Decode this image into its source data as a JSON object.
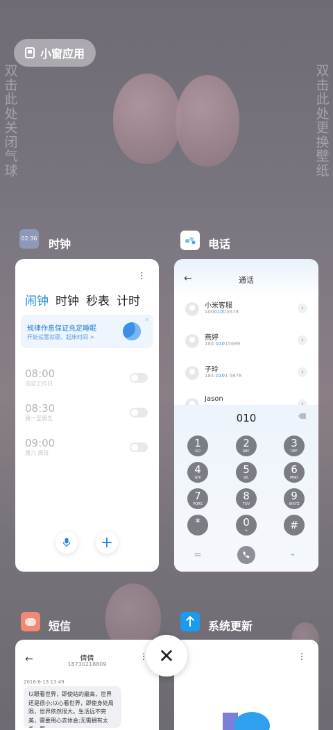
{
  "small_window": {
    "label": "小窗应用"
  },
  "hints": {
    "left": "双击此处关闭气球",
    "right": "双击此处更换壁纸"
  },
  "apps": {
    "clock": {
      "icon_time": "02:36",
      "name": "时钟",
      "tabs": [
        "闹钟",
        "时钟",
        "秒表",
        "计时"
      ],
      "banner": {
        "title": "规律作息保证充足睡眠",
        "subtitle": "开始设置就寝、起床时间 >"
      },
      "alarms": [
        {
          "time": "08:00",
          "repeat": "法定工作日"
        },
        {
          "time": "08:30",
          "repeat": "周一至周五"
        },
        {
          "time": "09:00",
          "repeat": "周六 周日"
        }
      ]
    },
    "phone": {
      "name": "电话",
      "header": "通话",
      "contacts": [
        {
          "name": "小米客服",
          "pre": "400",
          "hl": "010",
          "post": "05678"
        },
        {
          "name": "燕婷",
          "pre": "184 ",
          "hl": "010",
          "post": "15689"
        },
        {
          "name": "子玲",
          "pre": "184 ",
          "hl": "010",
          "post": "1 5678"
        },
        {
          "name": "Jason",
          "pre": "",
          "hl": "",
          "post": ""
        }
      ],
      "dial_input": "010",
      "keys": [
        {
          "n": "1",
          "l": "GO"
        },
        {
          "n": "2",
          "l": "ABC"
        },
        {
          "n": "3",
          "l": "DEF"
        },
        {
          "n": "4",
          "l": "GHI"
        },
        {
          "n": "5",
          "l": "JKL"
        },
        {
          "n": "6",
          "l": "MNO"
        },
        {
          "n": "7",
          "l": "PQRS"
        },
        {
          "n": "8",
          "l": "TUV"
        },
        {
          "n": "9",
          "l": "WXYZ"
        },
        {
          "n": "*",
          "l": ","
        },
        {
          "n": "0",
          "l": "+"
        },
        {
          "n": "#",
          "l": ""
        }
      ]
    },
    "sms": {
      "name": "短信",
      "contact_name": "倩倩",
      "contact_number": "18730218809",
      "timestamp": "2016-6-13 13:49",
      "message": "以眼看世界，即使站的最高，世界还是很小;以心看世界，即使身处局限，世界依然很大。生活远不完美，需要用心去体会;无需拥有太多，愿"
    },
    "update": {
      "name": "系统更新"
    }
  },
  "colors": {
    "accent": "#1f87e5",
    "key_bg": "#7a7d84"
  }
}
